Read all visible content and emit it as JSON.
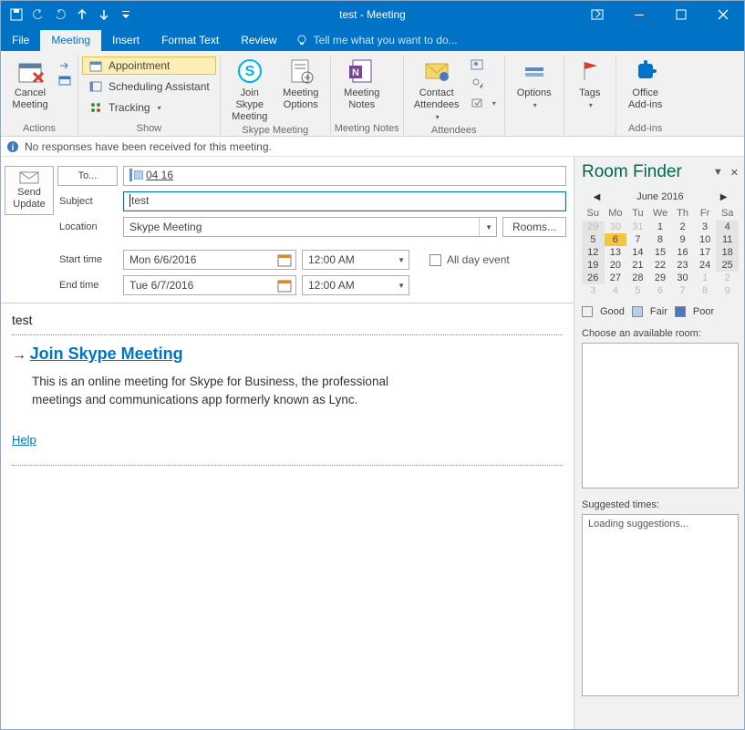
{
  "title": "test - Meeting",
  "tabs": {
    "file": "File",
    "meeting": "Meeting",
    "insert": "Insert",
    "format": "Format Text",
    "review": "Review",
    "tellme": "Tell me what you want to do..."
  },
  "ribbon": {
    "actions": {
      "cancel": "Cancel\nMeeting",
      "group": "Actions"
    },
    "show": {
      "appointment": "Appointment",
      "scheduling": "Scheduling Assistant",
      "tracking": "Tracking",
      "group": "Show"
    },
    "skype": {
      "join": "Join Skype\nMeeting",
      "options": "Meeting\nOptions",
      "group": "Skype Meeting"
    },
    "notes": {
      "notes": "Meeting\nNotes",
      "group": "Meeting Notes"
    },
    "attendees": {
      "contact": "Contact\nAttendees",
      "group": "Attendees"
    },
    "options": {
      "options": "Options",
      "group": ""
    },
    "tags": {
      "tags": "Tags",
      "group": ""
    },
    "addins": {
      "office": "Office\nAdd-ins",
      "group": "Add-ins"
    }
  },
  "info": "No responses have been received for this meeting.",
  "form": {
    "send": "Send\nUpdate",
    "to_label": "To...",
    "to_value": "04 16",
    "subject_label": "Subject",
    "subject_value": "test",
    "location_label": "Location",
    "location_value": "Skype Meeting",
    "rooms_btn": "Rooms...",
    "start_label": "Start time",
    "start_date": "Mon 6/6/2016",
    "end_label": "End time",
    "end_date": "Tue 6/7/2016",
    "time": "12:00 AM",
    "allday": "All day event"
  },
  "body": {
    "pre": "test",
    "skype_link": "Join Skype Meeting",
    "desc": "This is an online meeting for Skype for Business, the professional meetings and communications app formerly known as Lync.",
    "help": "Help"
  },
  "room": {
    "title": "Room Finder",
    "month": "June 2016",
    "dow": [
      "Su",
      "Mo",
      "Tu",
      "We",
      "Th",
      "Fr",
      "Sa"
    ],
    "weeks": [
      [
        {
          "d": "29",
          "c": "dim gray"
        },
        {
          "d": "30",
          "c": "dim"
        },
        {
          "d": "31",
          "c": "dim"
        },
        {
          "d": "1",
          "c": ""
        },
        {
          "d": "2",
          "c": ""
        },
        {
          "d": "3",
          "c": ""
        },
        {
          "d": "4",
          "c": "gray"
        }
      ],
      [
        {
          "d": "5",
          "c": "gray"
        },
        {
          "d": "6",
          "c": "hl"
        },
        {
          "d": "7",
          "c": ""
        },
        {
          "d": "8",
          "c": ""
        },
        {
          "d": "9",
          "c": ""
        },
        {
          "d": "10",
          "c": ""
        },
        {
          "d": "11",
          "c": "gray"
        }
      ],
      [
        {
          "d": "12",
          "c": "gray"
        },
        {
          "d": "13",
          "c": ""
        },
        {
          "d": "14",
          "c": ""
        },
        {
          "d": "15",
          "c": ""
        },
        {
          "d": "16",
          "c": ""
        },
        {
          "d": "17",
          "c": ""
        },
        {
          "d": "18",
          "c": "gray"
        }
      ],
      [
        {
          "d": "19",
          "c": "gray"
        },
        {
          "d": "20",
          "c": ""
        },
        {
          "d": "21",
          "c": ""
        },
        {
          "d": "22",
          "c": ""
        },
        {
          "d": "23",
          "c": ""
        },
        {
          "d": "24",
          "c": ""
        },
        {
          "d": "25",
          "c": "gray"
        }
      ],
      [
        {
          "d": "26",
          "c": "gray"
        },
        {
          "d": "27",
          "c": ""
        },
        {
          "d": "28",
          "c": ""
        },
        {
          "d": "29",
          "c": ""
        },
        {
          "d": "30",
          "c": ""
        },
        {
          "d": "1",
          "c": "dim"
        },
        {
          "d": "2",
          "c": "dim"
        }
      ],
      [
        {
          "d": "3",
          "c": "dim"
        },
        {
          "d": "4",
          "c": "dim"
        },
        {
          "d": "5",
          "c": "dim"
        },
        {
          "d": "6",
          "c": "dim"
        },
        {
          "d": "7",
          "c": "dim"
        },
        {
          "d": "8",
          "c": "dim"
        },
        {
          "d": "9",
          "c": "dim"
        }
      ]
    ],
    "good": "Good",
    "fair": "Fair",
    "poor": "Poor",
    "choose": "Choose an available room:",
    "suggested": "Suggested times:",
    "loading": "Loading suggestions..."
  }
}
